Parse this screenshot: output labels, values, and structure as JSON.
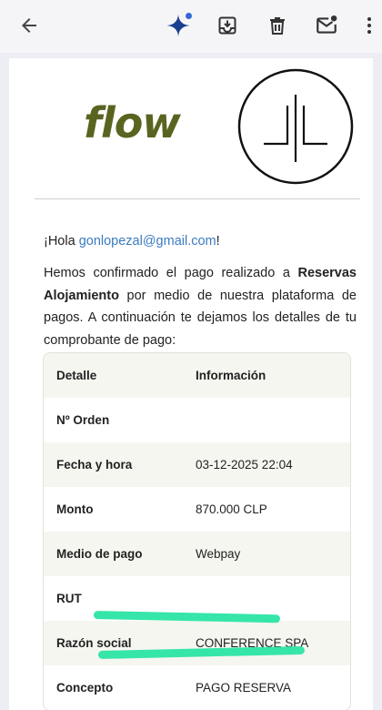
{
  "toolbar": {
    "icons": [
      "back-arrow-icon",
      "sparkle-icon",
      "archive-icon",
      "delete-icon",
      "mark-unread-icon",
      "more-vert-icon"
    ],
    "accent": "#1a3f8f",
    "badge_color": "#3568d4"
  },
  "email": {
    "brand": {
      "flow_text": "flow",
      "flow_color": "#5a6420"
    },
    "greeting_prefix": "¡Hola ",
    "greeting_email": "gonlopezal@gmail.com",
    "greeting_suffix": "!",
    "intro_part1": "Hemos confirmado el pago realizado a ",
    "intro_merchant": "Reservas Alojamiento",
    "intro_part2": " por medio de nuestra plataforma de pagos. A continuación te dejamos los detalles de tu comprobante de pago:",
    "table": {
      "header": {
        "key": "Detalle",
        "value": "Información"
      },
      "rows": [
        {
          "key": "Nº Orden",
          "value": ""
        },
        {
          "key": "Fecha y hora",
          "value": "03-12-2025 22:04"
        },
        {
          "key": "Monto",
          "value": "870.000 CLP"
        },
        {
          "key": "Medio de pago",
          "value": "Webpay"
        },
        {
          "key": "RUT",
          "value": ""
        },
        {
          "key": "Razón social",
          "value": "CONFERENCE SPA"
        },
        {
          "key": "Concepto",
          "value": "PAGO RESERVA"
        }
      ]
    },
    "highlight_color": "#35e6a8"
  }
}
